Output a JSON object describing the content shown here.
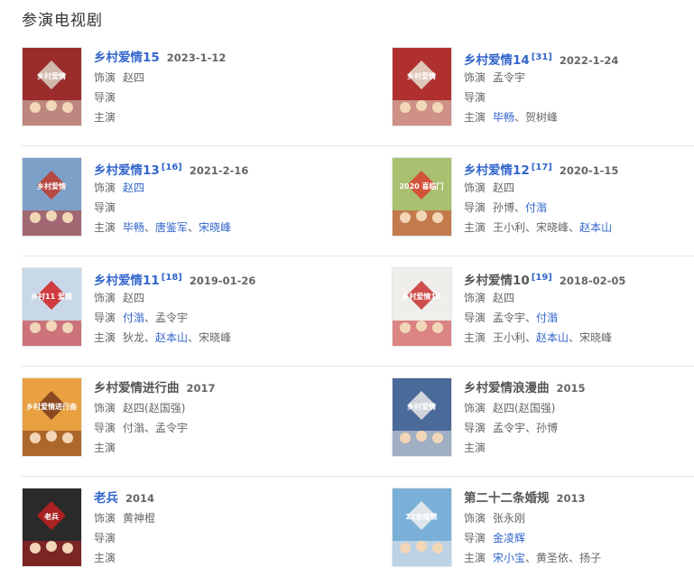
{
  "section_title": "参演电视剧",
  "labels": {
    "role": "饰演",
    "director": "导演",
    "cast": "主演"
  },
  "colors": {
    "link": "#3366cc",
    "text": "#666666",
    "divider": "#e8e8e8"
  },
  "dramas": [
    {
      "title": "乡村爱情15",
      "title_link": true,
      "ref": "",
      "date": "2023-1-12",
      "role": [
        {
          "name": "赵四",
          "link": false
        }
      ],
      "director": [],
      "cast": [],
      "poster": {
        "bg": "#9b2c2c",
        "accent": "#d9d2c2",
        "text": "乡村爱情"
      }
    },
    {
      "title": "乡村爱情14",
      "title_link": true,
      "ref": "[31]",
      "date": "2022-1-24",
      "role": [
        {
          "name": "孟令宇",
          "link": false
        }
      ],
      "director": [],
      "cast": [
        {
          "name": "毕畅",
          "link": true
        },
        {
          "name": "贺树峰",
          "link": false
        }
      ],
      "poster": {
        "bg": "#b03030",
        "accent": "#e8e0d0",
        "text": "乡村爱情"
      }
    },
    {
      "title": "乡村爱情13",
      "title_link": true,
      "ref": "[16]",
      "date": "2021-2-16",
      "role": [
        {
          "name": "赵四",
          "link": true
        }
      ],
      "director": [],
      "cast": [
        {
          "name": "毕畅",
          "link": true
        },
        {
          "name": "唐鉴军",
          "link": true
        },
        {
          "name": "宋晓峰",
          "link": true
        }
      ],
      "poster": {
        "bg": "#7da0c8",
        "accent": "#c0392b",
        "text": "乡村爱情"
      }
    },
    {
      "title": "乡村爱情12",
      "title_link": true,
      "ref": "[17]",
      "date": "2020-1-15",
      "role": [
        {
          "name": "赵四",
          "link": false
        }
      ],
      "director": [
        {
          "name": "孙博",
          "link": false
        },
        {
          "name": "付滃",
          "link": true
        }
      ],
      "cast": [
        {
          "name": "王小利",
          "link": false
        },
        {
          "name": "宋晓峰",
          "link": false
        },
        {
          "name": "赵本山",
          "link": true
        }
      ],
      "poster": {
        "bg": "#a8c070",
        "accent": "#d94030",
        "text": "2020 喜临门"
      }
    },
    {
      "title": "乡村爱情11",
      "title_link": true,
      "ref": "[18]",
      "date": "2019-01-26",
      "role": [
        {
          "name": "赵四",
          "link": false
        }
      ],
      "director": [
        {
          "name": "付滃",
          "link": true
        },
        {
          "name": "孟令宇",
          "link": false
        }
      ],
      "cast": [
        {
          "name": "狄龙",
          "link": false
        },
        {
          "name": "赵本山",
          "link": true
        },
        {
          "name": "宋晓峰",
          "link": false
        }
      ],
      "poster": {
        "bg": "#c8d8e8",
        "accent": "#d02020",
        "text": "乡村11 爱情"
      }
    },
    {
      "title": "乡村爱情10",
      "title_link": false,
      "ref": "[19]",
      "date": "2018-02-05",
      "role": [
        {
          "name": "赵四",
          "link": false
        }
      ],
      "director": [
        {
          "name": "孟令宇",
          "link": false
        },
        {
          "name": "付滃",
          "link": true
        }
      ],
      "cast": [
        {
          "name": "王小利",
          "link": false
        },
        {
          "name": "赵本山",
          "link": true
        },
        {
          "name": "宋晓峰",
          "link": false
        }
      ],
      "poster": {
        "bg": "#f0eeea",
        "accent": "#c83030",
        "text": "乡村爱情10"
      }
    },
    {
      "title": "乡村爱情进行曲",
      "title_link": false,
      "ref": "",
      "date": "2017",
      "role": [
        {
          "name": "赵四(赵国强)",
          "link": false
        }
      ],
      "director": [
        {
          "name": "付滃",
          "link": false
        },
        {
          "name": "孟令宇",
          "link": false
        }
      ],
      "cast": [],
      "poster": {
        "bg": "#e8a040",
        "accent": "#7a3a1a",
        "text": "乡村爱情进行曲"
      }
    },
    {
      "title": "乡村爱情浪漫曲",
      "title_link": false,
      "ref": "",
      "date": "2015",
      "role": [
        {
          "name": "赵四(赵国强)",
          "link": false
        }
      ],
      "director": [
        {
          "name": "孟令宇",
          "link": false
        },
        {
          "name": "孙博",
          "link": false
        }
      ],
      "cast": [],
      "poster": {
        "bg": "#4a6a9a",
        "accent": "#e8e8e8",
        "text": "乡村爱情"
      }
    },
    {
      "title": "老兵",
      "title_link": true,
      "ref": "",
      "date": "2014",
      "role": [
        {
          "name": "黄神棍",
          "link": false
        }
      ],
      "director": [],
      "cast": [],
      "poster": {
        "bg": "#2a2a2a",
        "accent": "#c02020",
        "text": "老兵"
      }
    },
    {
      "title": "第二十二条婚规",
      "title_link": false,
      "ref": "",
      "date": "2013",
      "role": [
        {
          "name": "张永刚",
          "link": false
        }
      ],
      "director": [
        {
          "name": "金凌辉",
          "link": true
        }
      ],
      "cast": [
        {
          "name": "宋小宝",
          "link": true
        },
        {
          "name": "黄圣依",
          "link": false
        },
        {
          "name": "扬子",
          "link": false
        }
      ],
      "poster": {
        "bg": "#7ab0d8",
        "accent": "#f0f0f0",
        "text": "22条婚规"
      }
    }
  ]
}
